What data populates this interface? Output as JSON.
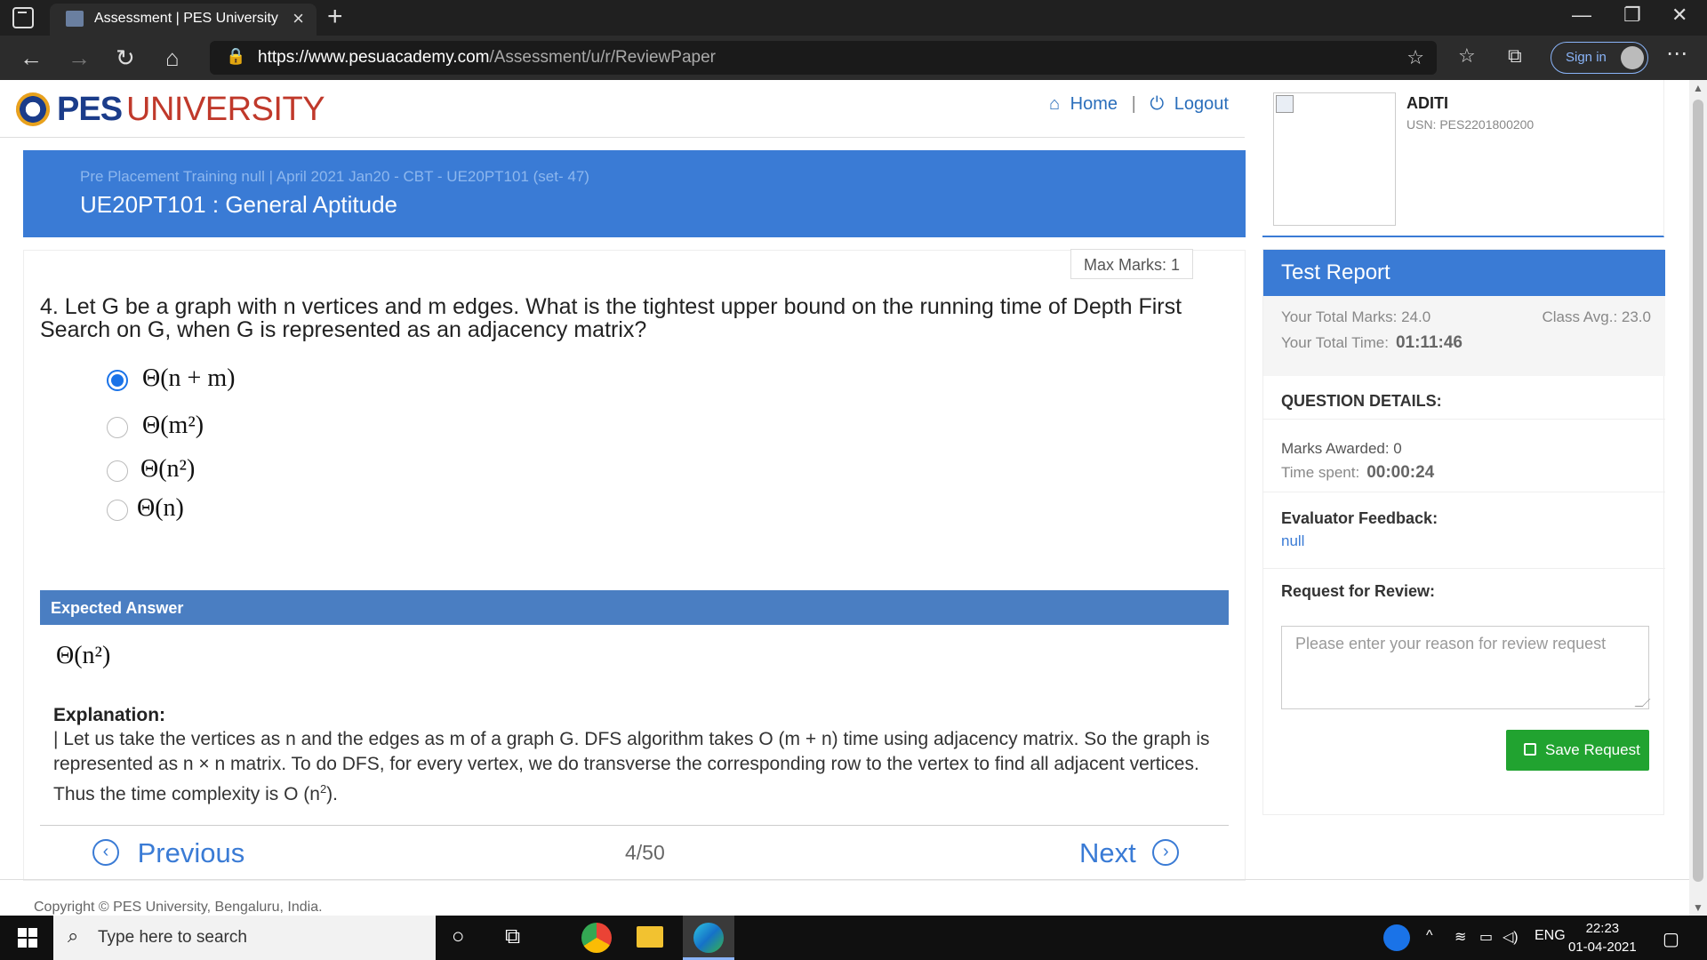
{
  "browser": {
    "tab_title": "Assessment | PES University",
    "url_host": "https://www.pesuacademy.com",
    "url_path": "/Assessment/u/r/ReviewPaper",
    "signin_label": "Sign in"
  },
  "header": {
    "logo_bold": "PES",
    "logo_rest": "UNIVERSITY",
    "nav": {
      "home": "Home",
      "logout": "Logout",
      "separator": "|"
    }
  },
  "banner": {
    "breadcrumb": "Pre Placement Training null | April 2021 Jan20 - CBT - UE20PT101 (set- 47)",
    "course": "UE20PT101 : General Aptitude"
  },
  "question": {
    "max_marks": "Max Marks: 1",
    "text": "4. Let G be a graph with n vertices and m edges. What is the tightest upper bound on the running time of Depth First Search on G, when G is represented as an adjacency matrix?",
    "options": [
      {
        "label": "Θ(n + m)",
        "selected": true
      },
      {
        "label": "Θ(m²)",
        "selected": false
      },
      {
        "label": "Θ(n²)",
        "selected": false
      },
      {
        "label": "Θ(n)",
        "selected": false
      }
    ],
    "expected_header": "Expected Answer",
    "expected_answer": "Θ(n²)",
    "explanation_title": "Explanation:",
    "explanation_text": "| Let us take the vertices as n and the edges as m of a graph G. DFS algorithm takes O (m + n) time using adjacency matrix. So the graph is represented as n × n matrix. To do DFS, for every vertex, we do transverse the corresponding row to the vertex to find all adjacent vertices. Thus the time complexity is O (n",
    "explanation_sup": "2",
    "explanation_end": ")."
  },
  "pagination": {
    "previous": "Previous",
    "next": "Next",
    "page": "4/50"
  },
  "footer": {
    "copyright": "Copyright © PES University, Bengaluru, India."
  },
  "profile": {
    "name": "ADITI",
    "usn": "USN: PES2201800200"
  },
  "report": {
    "title": "Test Report",
    "total_marks_label": "Your Total Marks: 24.0",
    "class_avg_label": "Class Avg.: 23.0",
    "total_time_label": "Your Total Time:",
    "total_time_value": "01:11:46",
    "question_details_label": "QUESTION DETAILS:",
    "marks_awarded_label": "Marks Awarded: 0",
    "time_spent_label": "Time spent:",
    "time_spent_value": "00:00:24",
    "feedback_label": "Evaluator Feedback:",
    "feedback_value": "null",
    "review_label": "Request for Review:",
    "review_placeholder": "Please enter your reason for review request",
    "save_label": "Save Request"
  },
  "taskbar": {
    "search_placeholder": "Type here to search",
    "lang": "ENG",
    "time": "22:23",
    "date": "01-04-2021"
  }
}
